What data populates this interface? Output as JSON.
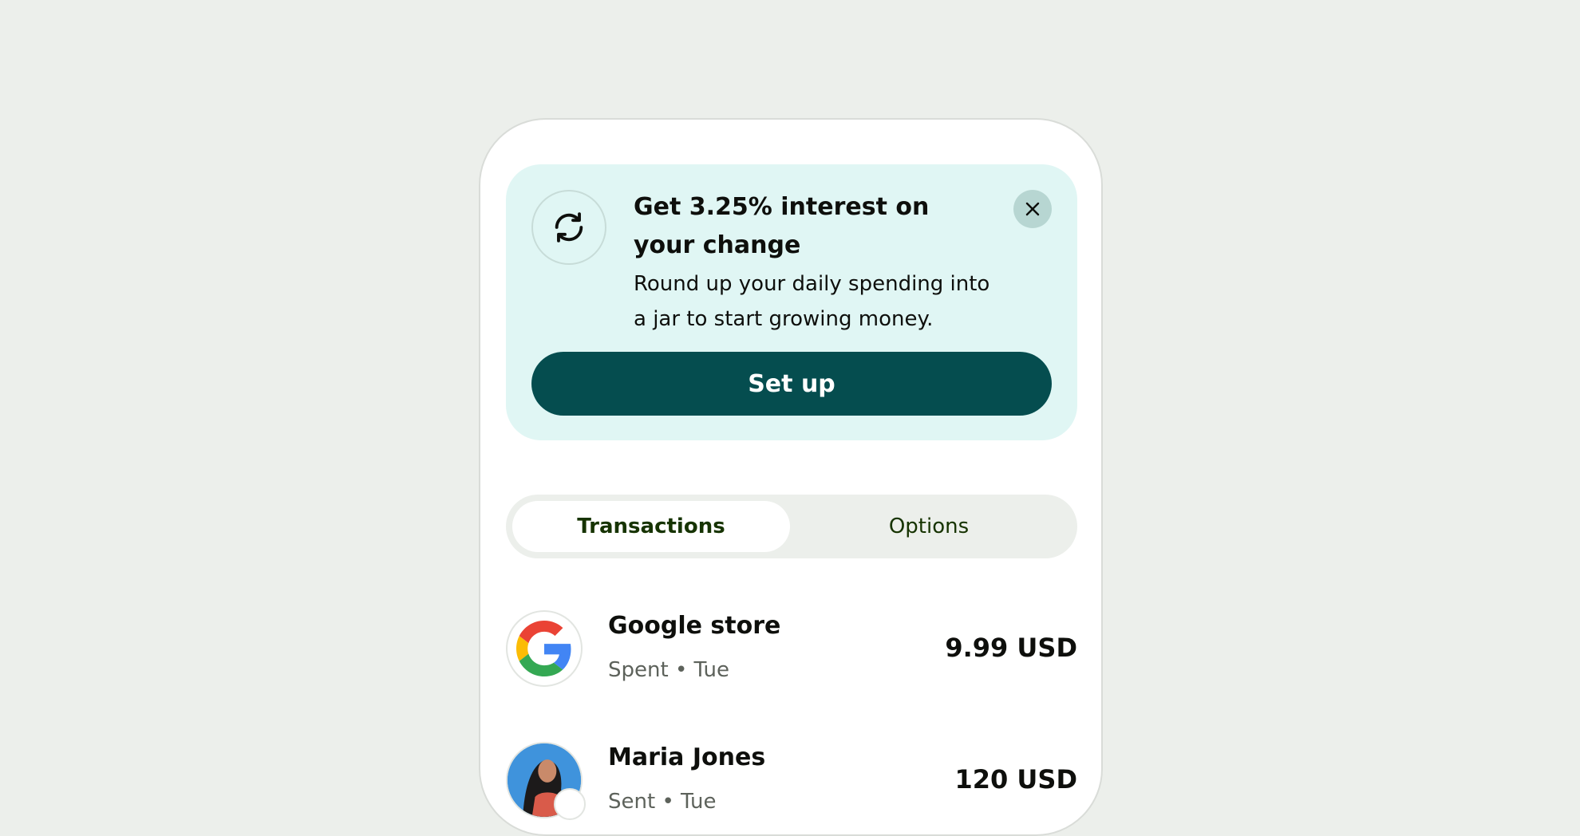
{
  "promo": {
    "icon": "refresh-icon",
    "title": "Get 3.25% interest on your change",
    "body": "Round up your daily spending into a jar to start growing money.",
    "cta_label": "Set up",
    "close_icon": "close-icon"
  },
  "tabs": [
    {
      "label": "Transactions",
      "selected": true
    },
    {
      "label": "Options",
      "selected": false
    }
  ],
  "transactions": [
    {
      "name": "Google store",
      "meta": "Spent • Tue",
      "amount": "9.99 USD",
      "avatar": "google-logo"
    },
    {
      "name": "Maria Jones",
      "meta": "Sent • Tue",
      "amount": "120 USD",
      "avatar": "person-photo"
    }
  ],
  "colors": {
    "background": "#ecefeb",
    "promo_bg": "#e0f6f4",
    "primary": "#054d4f",
    "tab_text": "#163300",
    "close_bg": "#b7d6d2"
  }
}
